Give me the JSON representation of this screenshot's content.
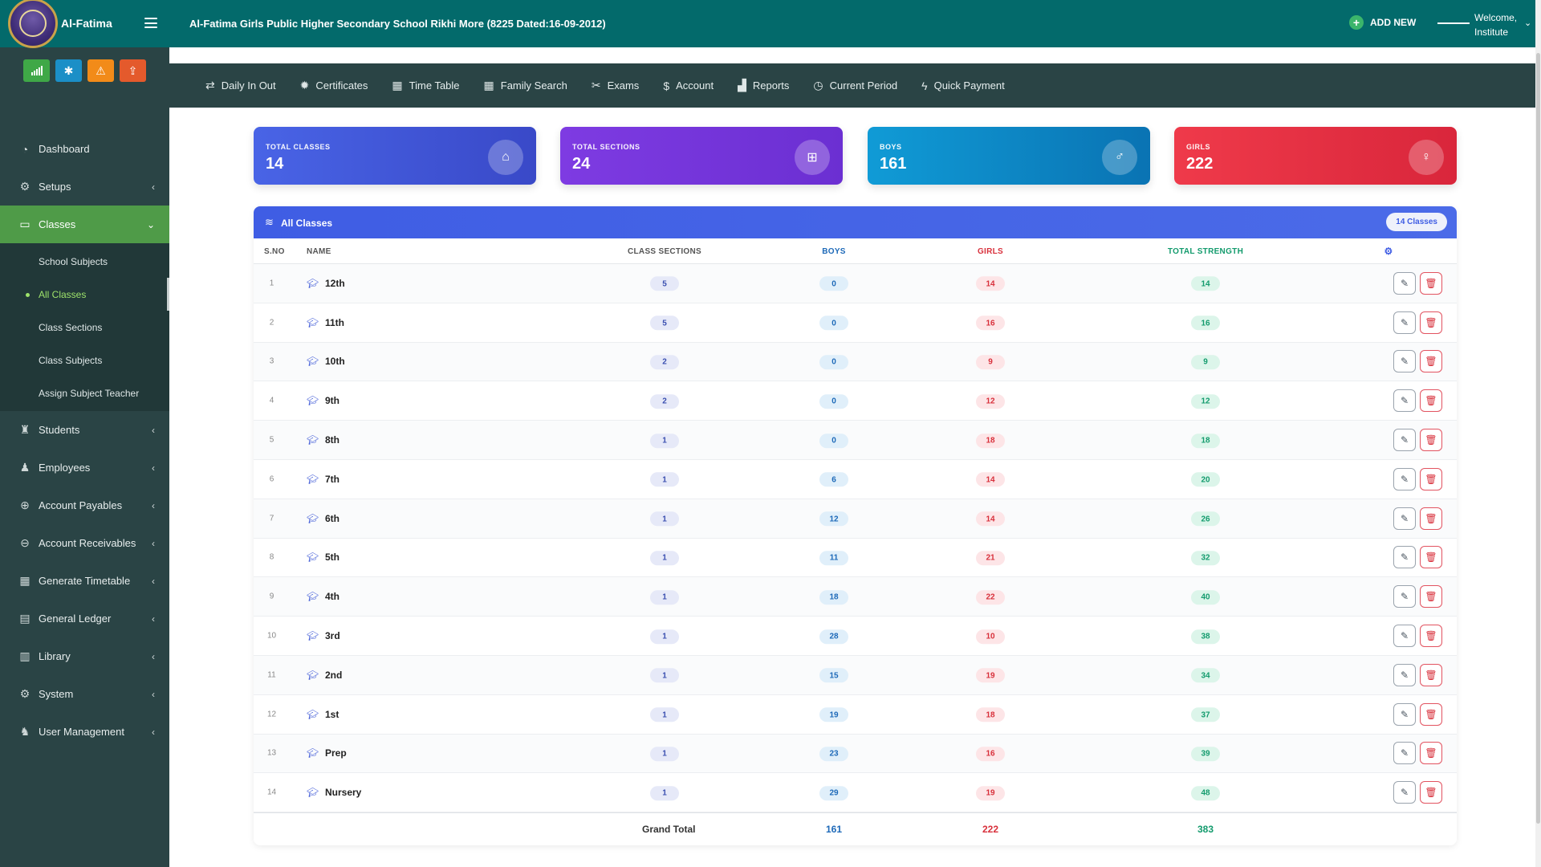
{
  "brand": {
    "name": "Al-Fatima"
  },
  "header": {
    "title": "Al-Fatima Girls Public Higher Secondary School Rikhi More (8225 Dated:16-09-2012)",
    "add_new": "ADD NEW",
    "welcome_line1": "Welcome,",
    "welcome_line2": "Institute"
  },
  "quick_buttons": [
    {
      "icon": "signal-icon",
      "color": "#3fa847"
    },
    {
      "icon": "cogs-icon",
      "color": "#1b8fc7"
    },
    {
      "icon": "warning-icon",
      "color": "#f28b19"
    },
    {
      "icon": "upload-icon",
      "color": "#e45a2c"
    }
  ],
  "sidebar": {
    "items": [
      {
        "label": "Dashboard",
        "icon": "dashboard-icon"
      },
      {
        "label": "Setups",
        "icon": "cogs-icon"
      },
      {
        "label": "Classes",
        "icon": "laptop-icon",
        "active": true
      },
      {
        "label": "Students",
        "icon": "student-icon"
      },
      {
        "label": "Employees",
        "icon": "user-icon"
      },
      {
        "label": "Account Payables",
        "icon": "arrow-up-circle-icon"
      },
      {
        "label": "Account Receivables",
        "icon": "arrow-down-circle-icon"
      },
      {
        "label": "Generate Timetable",
        "icon": "calendar-icon"
      },
      {
        "label": "General Ledger",
        "icon": "book-icon"
      },
      {
        "label": "Library",
        "icon": "library-icon"
      },
      {
        "label": "System",
        "icon": "gear-icon"
      },
      {
        "label": "User Management",
        "icon": "users-icon"
      }
    ],
    "classes_sub": [
      {
        "label": "School Subjects"
      },
      {
        "label": "All Classes",
        "active": true
      },
      {
        "label": "Class Sections"
      },
      {
        "label": "Class Subjects"
      },
      {
        "label": "Assign Subject Teacher"
      }
    ]
  },
  "menubar": [
    {
      "label": "Daily In Out",
      "icon": "exchange-icon"
    },
    {
      "label": "Certificates",
      "icon": "certificate-icon"
    },
    {
      "label": "Time Table",
      "icon": "calendar-icon"
    },
    {
      "label": "Family Search",
      "icon": "calendar-icon"
    },
    {
      "label": "Exams",
      "icon": "tools-icon"
    },
    {
      "label": "Account",
      "icon": "dollar-icon"
    },
    {
      "label": "Reports",
      "icon": "bar-chart-icon"
    },
    {
      "label": "Current Period",
      "icon": "clock-icon"
    },
    {
      "label": "Quick Payment",
      "icon": "bolt-icon"
    }
  ],
  "stats": [
    {
      "label": "TOTAL CLASSES",
      "value": "14",
      "icon": "school-icon",
      "color": "#4964e6"
    },
    {
      "label": "TOTAL SECTIONS",
      "value": "24",
      "icon": "grid-icon",
      "color": "#7e3be2"
    },
    {
      "label": "BOYS",
      "value": "161",
      "icon": "male-icon",
      "color": "#109bd6"
    },
    {
      "label": "GIRLS",
      "value": "222",
      "icon": "female-icon",
      "color": "#ef3a4a"
    }
  ],
  "table": {
    "title": "All Classes",
    "badge": "14 Classes",
    "columns": [
      "S.NO",
      "NAME",
      "CLASS SECTIONS",
      "BOYS",
      "GIRLS",
      "TOTAL STRENGTH"
    ],
    "rows": [
      {
        "sno": "1",
        "name": "12th",
        "sections": "5",
        "boys": "0",
        "girls": "14",
        "total": "14"
      },
      {
        "sno": "2",
        "name": "11th",
        "sections": "5",
        "boys": "0",
        "girls": "16",
        "total": "16"
      },
      {
        "sno": "3",
        "name": "10th",
        "sections": "2",
        "boys": "0",
        "girls": "9",
        "total": "9"
      },
      {
        "sno": "4",
        "name": "9th",
        "sections": "2",
        "boys": "0",
        "girls": "12",
        "total": "12"
      },
      {
        "sno": "5",
        "name": "8th",
        "sections": "1",
        "boys": "0",
        "girls": "18",
        "total": "18"
      },
      {
        "sno": "6",
        "name": "7th",
        "sections": "1",
        "boys": "6",
        "girls": "14",
        "total": "20"
      },
      {
        "sno": "7",
        "name": "6th",
        "sections": "1",
        "boys": "12",
        "girls": "14",
        "total": "26"
      },
      {
        "sno": "8",
        "name": "5th",
        "sections": "1",
        "boys": "11",
        "girls": "21",
        "total": "32"
      },
      {
        "sno": "9",
        "name": "4th",
        "sections": "1",
        "boys": "18",
        "girls": "22",
        "total": "40"
      },
      {
        "sno": "10",
        "name": "3rd",
        "sections": "1",
        "boys": "28",
        "girls": "10",
        "total": "38"
      },
      {
        "sno": "11",
        "name": "2nd",
        "sections": "1",
        "boys": "15",
        "girls": "19",
        "total": "34"
      },
      {
        "sno": "12",
        "name": "1st",
        "sections": "1",
        "boys": "19",
        "girls": "18",
        "total": "37"
      },
      {
        "sno": "13",
        "name": "Prep",
        "sections": "1",
        "boys": "23",
        "girls": "16",
        "total": "39"
      },
      {
        "sno": "14",
        "name": "Nursery",
        "sections": "1",
        "boys": "29",
        "girls": "19",
        "total": "48"
      }
    ],
    "footer": {
      "label": "Grand Total",
      "boys": "161",
      "girls": "222",
      "total": "383"
    }
  }
}
